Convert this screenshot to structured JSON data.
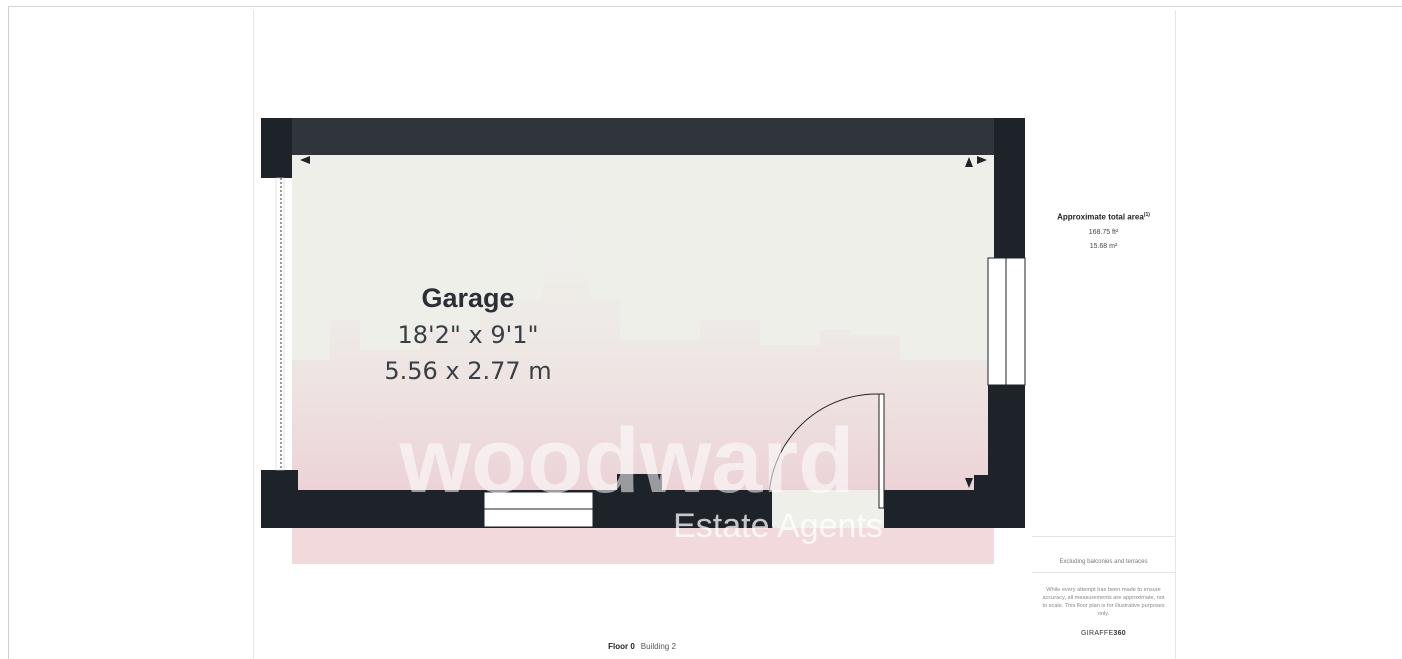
{
  "room": {
    "name": "Garage",
    "imperial": "18'2\" x 9'1\"",
    "metric": "5.56 x 2.77 m"
  },
  "watermark": {
    "brand": "woodward",
    "tagline": "Estate Agents"
  },
  "floor": {
    "label": "Floor 0",
    "building": "Building 2"
  },
  "area": {
    "title": "Approximate total area",
    "title_marker": "(1)",
    "imperial": "168.75 ft²",
    "metric": "15.68 m²",
    "exclusion_note": "Excluding balconies and terraces",
    "disclaimer": "While every attempt has been made to ensure accuracy, all measurements are approximate, not to scale. This floor plan is for illustrative purposes only.",
    "brand_name": "GIRAFFE",
    "brand_suffix": "360"
  },
  "colors": {
    "wall": "#1e232a",
    "top_wall": "#2f353b",
    "floor": "#efefea",
    "watermark_tint": "#f0d5d9",
    "watermark_text": "#ffffff"
  }
}
